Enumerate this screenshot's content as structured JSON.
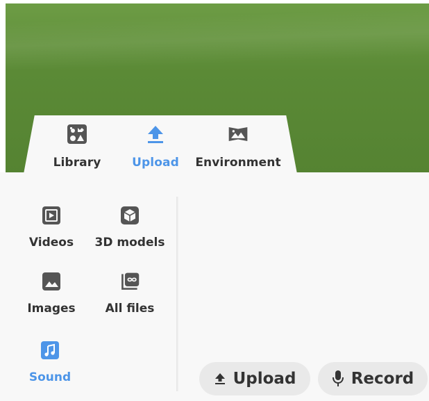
{
  "tabs": [
    {
      "label": "Library",
      "icon": "library-icon",
      "active": false
    },
    {
      "label": "Upload",
      "icon": "upload-arrow-icon",
      "active": true
    },
    {
      "label": "Environment",
      "icon": "environment-icon",
      "active": false
    }
  ],
  "sidebar": {
    "items": [
      {
        "label": "Videos",
        "icon": "video-play-icon"
      },
      {
        "label": "3D models",
        "icon": "cube-icon"
      },
      {
        "label": "Images",
        "icon": "image-icon"
      },
      {
        "label": "All files",
        "icon": "all-files-infinity-icon"
      },
      {
        "label": "Sound",
        "icon": "music-note-icon",
        "active": true
      }
    ]
  },
  "actions": {
    "upload_label": "Upload",
    "record_label": "Record"
  },
  "colors": {
    "accent": "#4d95e8",
    "icon": "#555555",
    "scene_green": "#5b8a36"
  }
}
